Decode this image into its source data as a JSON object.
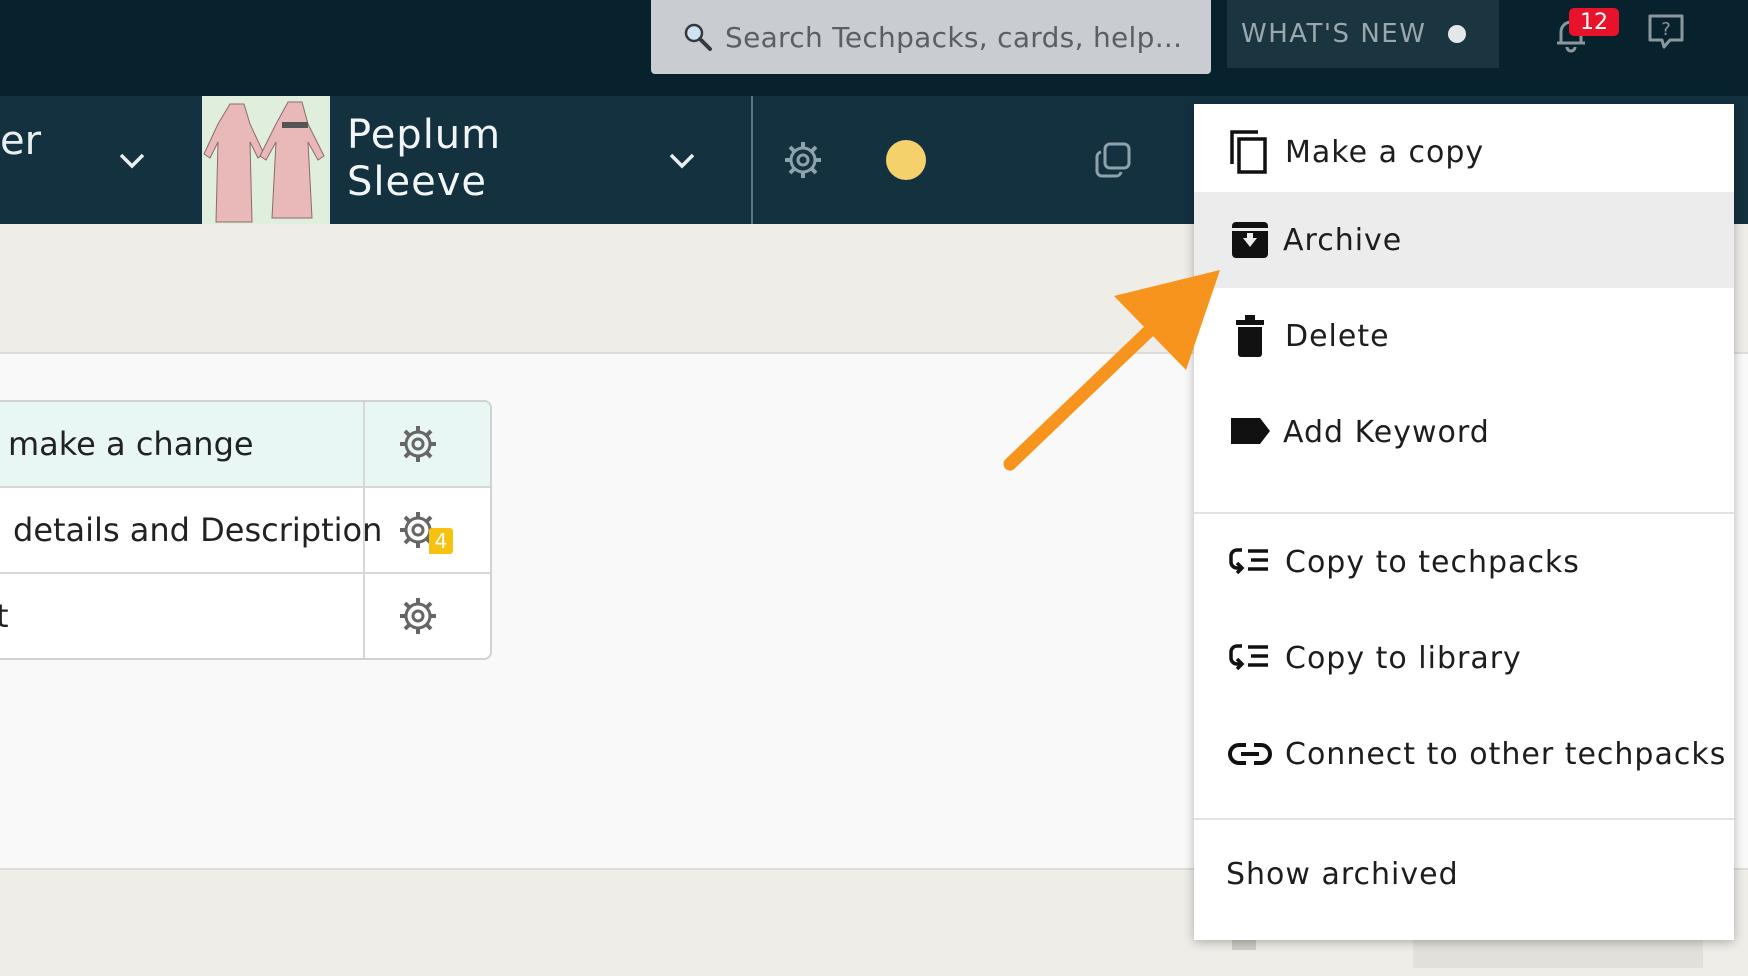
{
  "header": {
    "search_placeholder": "Search Techpacks, cards, help...",
    "whats_new": "WHAT'S NEW",
    "notification_count": "12"
  },
  "techpack_bar": {
    "previous_name_fragment": "er",
    "style_name_line1": "Peplum",
    "style_name_line2": "Sleeve",
    "status_color": "#f5d16b"
  },
  "table": {
    "rows": [
      {
        "text": "make a change",
        "comments": ""
      },
      {
        "text": "details and Description",
        "comments": "4"
      },
      {
        "text": "t",
        "comments": ""
      }
    ]
  },
  "menu": {
    "items": [
      {
        "label": "Make a copy",
        "icon": "copy-icon"
      },
      {
        "label": "Archive",
        "icon": "archive-icon"
      },
      {
        "label": "Delete",
        "icon": "trash-icon"
      },
      {
        "label": "Add Keyword",
        "icon": "tag-icon"
      },
      {
        "label": "Copy to techpacks",
        "icon": "copy-list-icon"
      },
      {
        "label": "Copy to library",
        "icon": "copy-list-icon"
      },
      {
        "label": "Connect to other techpacks",
        "icon": "link-icon"
      }
    ],
    "show_archived": "Show archived"
  },
  "annotation": {
    "arrow_color": "#f7941d"
  }
}
